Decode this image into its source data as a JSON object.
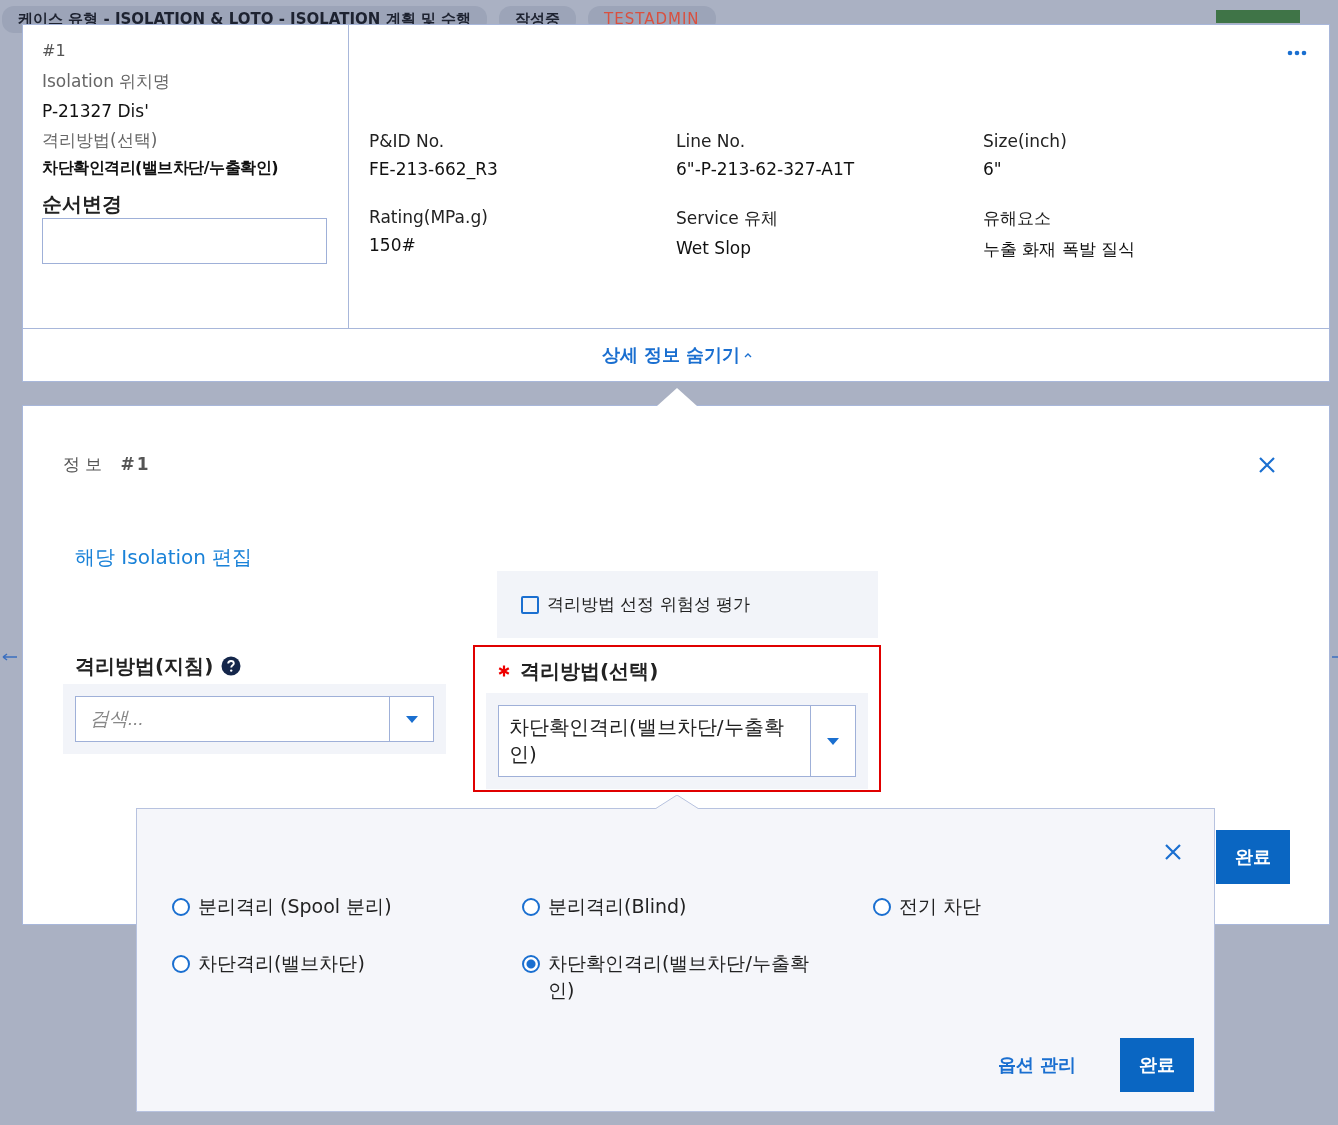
{
  "background": {
    "breadcrumb": "케이스 유형 - ISOLATION & LOTO - ISOLATION 계획 및 수행",
    "status": "작성중",
    "user": "TESTADMIN"
  },
  "summary_card": {
    "number": "#1",
    "location_label": "Isolation 위치명",
    "location": "P-21327 Dis'",
    "method_label": "격리방법(선택)",
    "method": "차단확인격리(밸브차단/누출확인)",
    "order_label": "순서변경",
    "fields": [
      {
        "label": "P&ID No.",
        "value": "FE-213-662_R3"
      },
      {
        "label": "Line No.",
        "value": "6\"-P-213-62-327-A1T"
      },
      {
        "label": "Size(inch)",
        "value": "6\""
      },
      {
        "label": "Rating(MPa.g)",
        "value": "150#"
      },
      {
        "label": "Service 유체",
        "value": "Wet Slop"
      },
      {
        "label": "유해요소",
        "value": "누출 화재 폭발 질식"
      }
    ],
    "toggle": "상세 정보 숨기기"
  },
  "info_panel": {
    "title": "정 보",
    "number": "#1",
    "edit_link": "해당 Isolation 편집",
    "risk_check": {
      "label": "격리방법 선정 위험성 평가",
      "checked": false
    },
    "guideline": {
      "label": "격리방법(지침)",
      "placeholder": "검색..."
    },
    "selection": {
      "label": "격리방법(선택)",
      "required": true,
      "highlighted": true,
      "value": "차단확인격리(밸브차단/누출확인)"
    },
    "done_button": "완료"
  },
  "options_popover": {
    "options": [
      {
        "label": "분리격리 (Spool 분리)",
        "selected": false
      },
      {
        "label": "분리격리(Blind)",
        "selected": false
      },
      {
        "label": "전기 차단",
        "selected": false
      },
      {
        "label": "차단격리(밸브차단)",
        "selected": false
      },
      {
        "label": "차단확인격리(밸브차단/누출확인)",
        "selected": true
      }
    ],
    "manage_link": "옵션 관리",
    "done_button": "완료"
  }
}
